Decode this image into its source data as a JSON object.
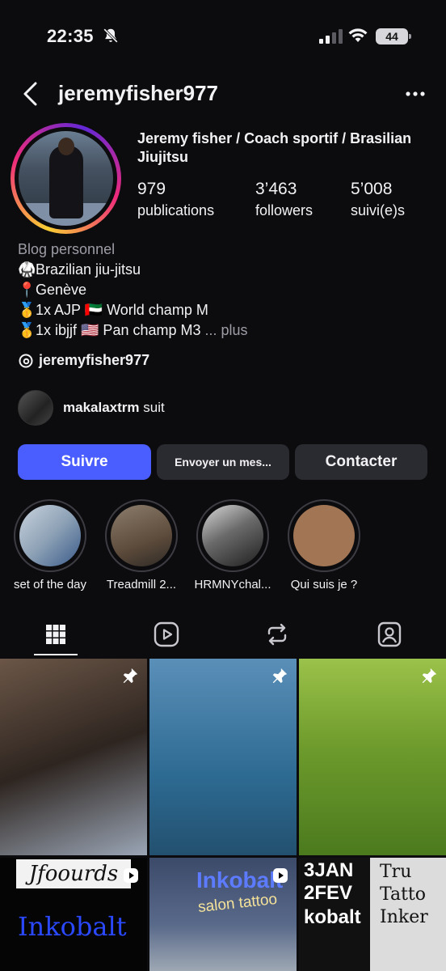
{
  "status_bar": {
    "time": "22:35",
    "battery": "44"
  },
  "header": {
    "username": "jeremyfisher977"
  },
  "profile": {
    "full_name": "Jeremy fisher / Coach sportif / Brasilian Jiujitsu",
    "stats": [
      {
        "value": "979",
        "label": "publications"
      },
      {
        "value": "3’463",
        "label": "followers"
      },
      {
        "value": "5’008",
        "label": "suivi(e)s"
      }
    ],
    "bio_category": "Blog personnel",
    "bio_lines": [
      {
        "emoji": "🥋",
        "text": "Brazilian jiu-jitsu"
      },
      {
        "emoji": "📍",
        "text": "Genève"
      },
      {
        "emoji": "🥇",
        "text": "1x AJP 🇦🇪  World champ M"
      },
      {
        "emoji": "🥇",
        "text": "1x ibjjf 🇺🇸  Pan champ M3"
      }
    ],
    "bio_more": "... plus",
    "threads_handle": "jeremyfisher977",
    "followed_by": {
      "user": "makalaxtrm",
      "suffix": "suit"
    }
  },
  "actions": {
    "follow": "Suivre",
    "message": "Envoyer un mes...",
    "contact": "Contacter"
  },
  "highlights": [
    {
      "label": "set of the day",
      "color": "#8a9bb0"
    },
    {
      "label": "Treadmill 2...",
      "color": "#6b5a4a"
    },
    {
      "label": "HRMNYchal...",
      "color": "#4a4a4e"
    },
    {
      "label": "Qui suis je ?",
      "color": "#a27654"
    }
  ],
  "tabs": [
    "grid-tab",
    "reels-tab",
    "reposts-tab",
    "tagged-tab"
  ],
  "posts": {
    "p4_title": "Jfoourds",
    "p4_brand": "Inkobalt",
    "p5_title": "Inkobalt",
    "p5_sub": "salon tattoo",
    "p6_left": [
      "3JAN",
      "2FEV",
      "kobalt"
    ],
    "p6_right": [
      "Tru",
      "Tatto",
      "Inker"
    ]
  }
}
